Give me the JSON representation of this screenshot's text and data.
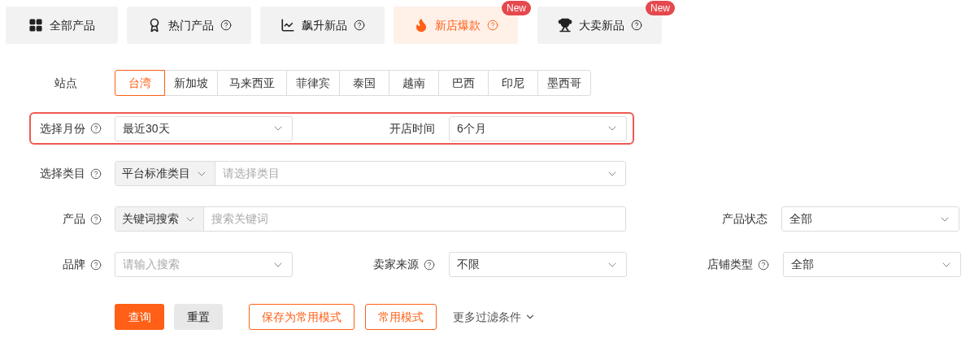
{
  "tabs": [
    {
      "label": "全部产品",
      "help": false,
      "selected": false
    },
    {
      "label": "热门产品",
      "help": true,
      "selected": false
    },
    {
      "label": "飙升新品",
      "help": true,
      "selected": false
    },
    {
      "label": "新店爆款",
      "help": true,
      "badge": "New",
      "selected": true
    },
    {
      "label": "大卖新品",
      "help": true,
      "badge": "New",
      "selected": false
    }
  ],
  "site": {
    "label": "站点",
    "options": [
      {
        "label": "台湾",
        "selected": true
      },
      {
        "label": "新加坡",
        "selected": false
      },
      {
        "label": "马来西亚",
        "selected": false
      },
      {
        "label": "菲律宾",
        "selected": false
      },
      {
        "label": "泰国",
        "selected": false
      },
      {
        "label": "越南",
        "selected": false
      },
      {
        "label": "巴西",
        "selected": false
      },
      {
        "label": "印尼",
        "selected": false
      },
      {
        "label": "墨西哥",
        "selected": false
      }
    ]
  },
  "filter_rows": [
    {
      "highlighted": true,
      "fields": [
        {
          "kind": "select",
          "label": "选择月份",
          "help": true,
          "value": "最近30天"
        },
        {
          "kind": "select",
          "label": "开店时间",
          "help": false,
          "value": "6个月"
        }
      ]
    },
    {
      "highlighted": false,
      "fields": [
        {
          "kind": "compound",
          "label": "选择类目",
          "help": true,
          "mode": "平台标准类目",
          "placeholder": "请选择类目",
          "dropdown": true
        }
      ]
    },
    {
      "highlighted": false,
      "fields": [
        {
          "kind": "compound",
          "label": "产品",
          "help": true,
          "mode": "关键词搜索",
          "placeholder": "搜索关键词",
          "dropdown": false
        },
        {
          "kind": "select",
          "label": "产品状态",
          "help": false,
          "value": "全部"
        }
      ]
    },
    {
      "highlighted": false,
      "fields": [
        {
          "kind": "select",
          "label": "品牌",
          "help": true,
          "placeholder": "请输入搜索"
        },
        {
          "kind": "select",
          "label": "卖家来源",
          "help": true,
          "value": "不限"
        },
        {
          "kind": "select",
          "label": "店铺类型",
          "help": true,
          "value": "全部"
        }
      ]
    }
  ],
  "actions": [
    {
      "kind": "primary",
      "label": "查询"
    },
    {
      "kind": "secondary",
      "label": "重置"
    },
    {
      "kind": "outline",
      "label": "保存为常用模式"
    },
    {
      "kind": "outline",
      "label": "常用模式"
    },
    {
      "kind": "link",
      "label": "更多过滤条件"
    }
  ]
}
